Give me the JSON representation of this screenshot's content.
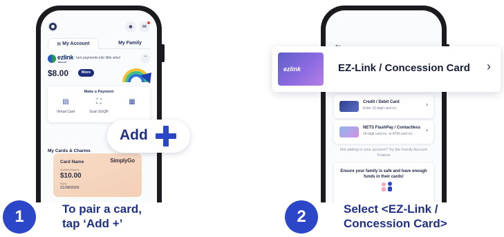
{
  "colors": {
    "accent": "#2b46c7",
    "navy": "#1f2f86",
    "card_peach": "#f3cfb6",
    "ez_card_purple": "#6a62d4"
  },
  "phone1": {
    "tabs": {
      "my_account": "My Account",
      "my_family": "My Family"
    },
    "ezlink": {
      "logo": "ezlink",
      "wallet": "WALLET",
      "tagline": "- turn payments into little wins!"
    },
    "balance": "$8.00",
    "more_label": "More",
    "payment": {
      "title": "Make a Payment",
      "items": [
        {
          "label": "Virtual Card",
          "icon": "card-icon"
        },
        {
          "label": "Scan SGQR",
          "icon": "scan-icon"
        },
        {
          "label": "",
          "icon": "qr-icon"
        }
      ]
    },
    "cards_title": "My Cards & Charms",
    "charm_card": {
      "name": "Card Name",
      "brand": "SimplyGo",
      "available_label": "Available Balance",
      "balance": "$10.00",
      "expiry_label": "Expiry",
      "expiry": "21/08/2026"
    },
    "add_button": {
      "label": "Add",
      "icon": "plus-icon"
    }
  },
  "phone2": {
    "ez_option": {
      "card_logo": "ezlink",
      "label": "EZ-Link / Concession Card"
    },
    "credit": {
      "title": "Credit / Debit Card",
      "subtitle": "Enter 16-digit card no."
    },
    "nets": {
      "title": "NETS FlashPay / Contactless",
      "subtitle": "16-digit card no. or ATM card no."
    },
    "family_note": "Not adding to your account? Try the Family Account Feature",
    "family_card": "Ensure your family is safe and have enough funds in their cards!"
  },
  "steps": [
    {
      "number": "1",
      "line1": "To pair a card,",
      "line2": "tap ‘Add +’"
    },
    {
      "number": "2",
      "line1": "Select <EZ-Link /",
      "line2": "Concession Card>"
    }
  ]
}
